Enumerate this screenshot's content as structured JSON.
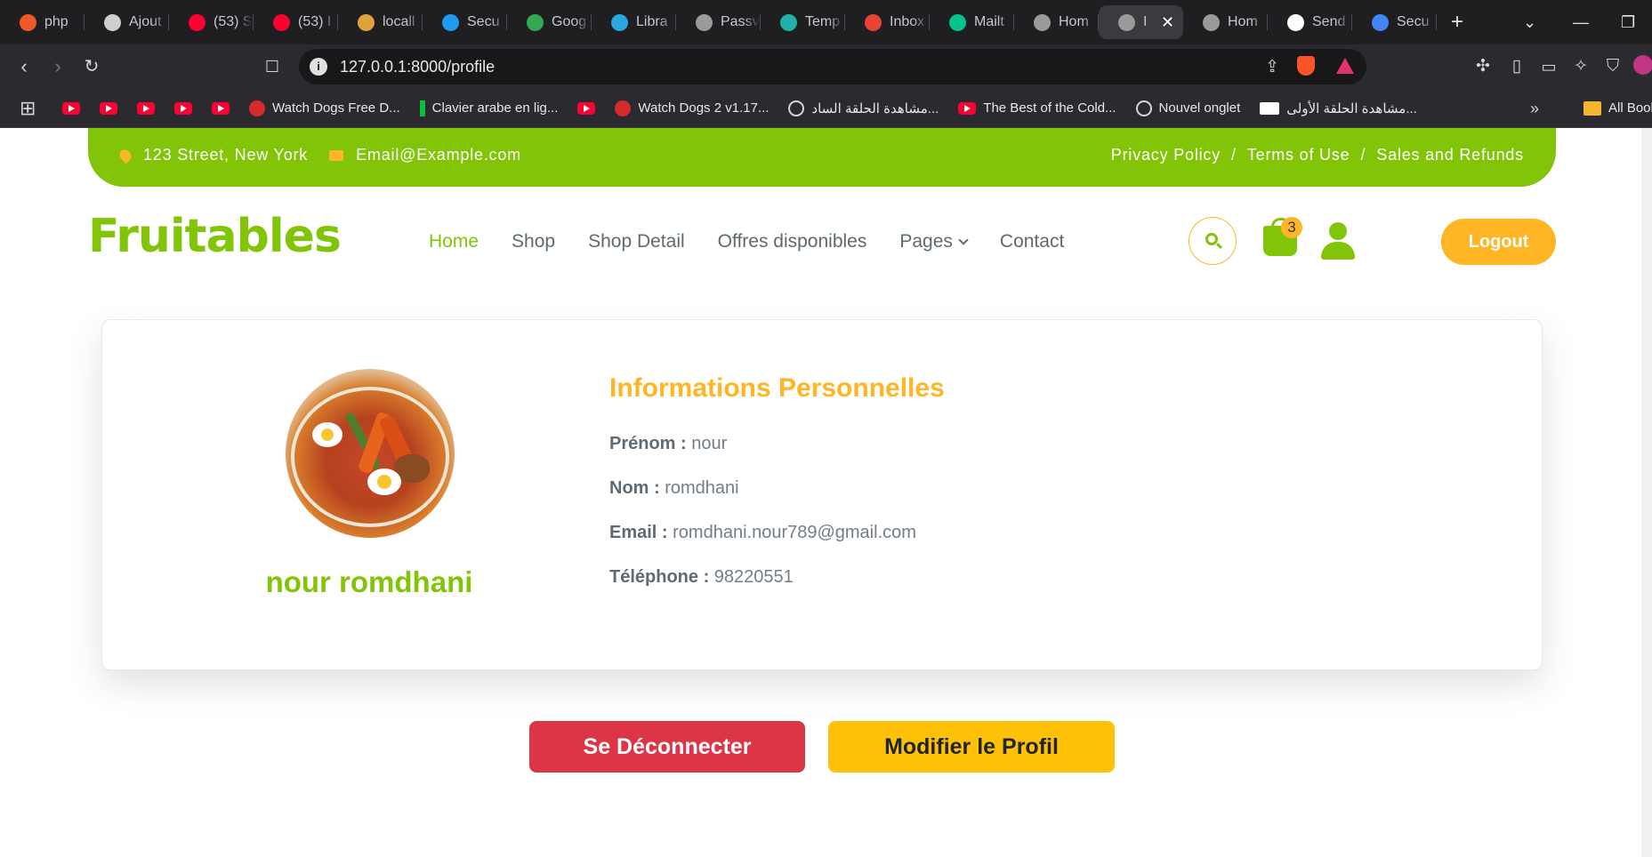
{
  "browser": {
    "tabs": [
      {
        "title": "php",
        "color": "#f05a28",
        "icon": "php-icon"
      },
      {
        "title": "Ajout",
        "color": "#cfcfcf",
        "icon": "openai-icon"
      },
      {
        "title": "(53) S",
        "color": "#ff0033",
        "icon": "youtube-icon"
      },
      {
        "title": "(53) I",
        "color": "#ff0033",
        "icon": "youtube-icon"
      },
      {
        "title": "locall",
        "color": "#e0a33a",
        "icon": "localhost-icon"
      },
      {
        "title": "Secu",
        "color": "#1d9bf0",
        "icon": "security-icon"
      },
      {
        "title": "Goog",
        "color": "#34a853",
        "icon": "google-meet-icon"
      },
      {
        "title": "Libra",
        "color": "#2aa7e0",
        "icon": "libra-icon"
      },
      {
        "title": "Passv",
        "color": "#9a9a9a",
        "icon": "globe-icon"
      },
      {
        "title": "Temp",
        "color": "#20b2aa",
        "icon": "temp-mail-icon"
      },
      {
        "title": "Inbox",
        "color": "#ea4335",
        "icon": "gmail-icon"
      },
      {
        "title": "Mailt",
        "color": "#00c48c",
        "icon": "mailtrap-icon"
      },
      {
        "title": "Hom",
        "color": "#9a9a9a",
        "icon": "globe-icon"
      },
      {
        "title": "I",
        "color": "#9a9a9a",
        "icon": "globe-icon",
        "active": true
      },
      {
        "title": "Hom",
        "color": "#9a9a9a",
        "icon": "globe-icon"
      },
      {
        "title": "Send",
        "color": "#ffffff",
        "icon": "symfony-icon"
      },
      {
        "title": "Secu",
        "color": "#4285f4",
        "icon": "google-icon"
      }
    ],
    "url": "127.0.0.1:8000/profile",
    "bookmarks": [
      {
        "label": "",
        "icon": "yt"
      },
      {
        "label": "",
        "icon": "yt"
      },
      {
        "label": "",
        "icon": "yt"
      },
      {
        "label": "",
        "icon": "yt"
      },
      {
        "label": "",
        "icon": "yt"
      },
      {
        "label": "Watch Dogs Free D...",
        "icon": "red"
      },
      {
        "label": "Clavier arabe en lig...",
        "icon": "green"
      },
      {
        "label": "",
        "icon": "yt"
      },
      {
        "label": "Watch Dogs 2 v1.17...",
        "icon": "red"
      },
      {
        "label": "مشاهدة الحلقة الساد...",
        "icon": "globe"
      },
      {
        "label": "The Best of the Cold...",
        "icon": "yt"
      },
      {
        "label": "Nouvel onglet",
        "icon": "globe"
      },
      {
        "label": "مشاهدة الحلقة الأولى...",
        "icon": "small"
      }
    ],
    "all_bookmarks": "All Book"
  },
  "topbar": {
    "address": "123 Street, New York",
    "email": "Email@Example.com",
    "links": [
      "Privacy Policy",
      "/",
      "Terms of Use",
      "/",
      "Sales and Refunds"
    ]
  },
  "header": {
    "brand": "Fruitables",
    "nav": [
      "Home",
      "Shop",
      "Shop Detail",
      "Offres disponibles",
      "Pages",
      "Contact"
    ],
    "cart_count": "3",
    "logout": "Logout"
  },
  "profile": {
    "full_name": "nour romdhani",
    "section_title": "Informations Personnelles",
    "fields": [
      {
        "label": "Prénom :",
        "value": "nour"
      },
      {
        "label": "Nom :",
        "value": "romdhani"
      },
      {
        "label": "Email :",
        "value": "romdhani.nour789@gmail.com"
      },
      {
        "label": "Téléphone :",
        "value": "98220551"
      }
    ]
  },
  "actions": {
    "logout_button": "Se Déconnecter",
    "edit_button": "Modifier le Profil"
  }
}
